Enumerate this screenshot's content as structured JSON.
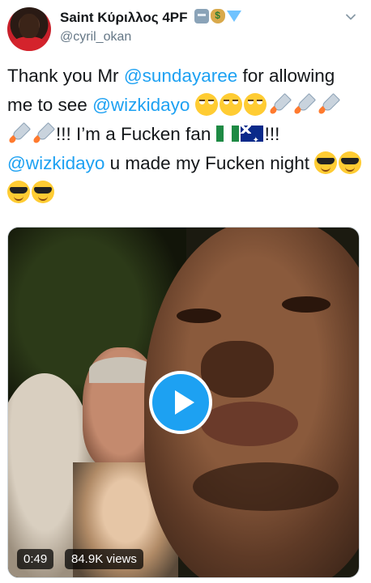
{
  "user": {
    "display_name": "Saint Κύριλλος 4PF",
    "handle": "@cyril_okan",
    "name_emojis": [
      "robot-emoji",
      "money-bag-emoji",
      "gem-emoji"
    ]
  },
  "tweet": {
    "segments": [
      {
        "text": "Thank you Mr ",
        "type": "text"
      },
      {
        "text": "@sundayaree",
        "type": "mention"
      },
      {
        "text": " for allowing me to see ",
        "type": "text"
      },
      {
        "text": "@wizkidayo",
        "type": "mention"
      },
      {
        "text": " ",
        "type": "text"
      }
    ],
    "part2": "!!! I’m a Fucken fan ",
    "part3": "!!! ",
    "mention3": "@wizkidayo",
    "part4": " u made my Fucken night ",
    "emoji_sequence_1": [
      "face-with-rolling-eyes",
      "face-with-rolling-eyes",
      "face-with-rolling-eyes"
    ],
    "emoji_sequence_rockets": [
      "rocket",
      "rocket",
      "rocket",
      "rocket",
      "rocket"
    ],
    "flags": [
      "nigeria-flag",
      "australia-flag"
    ],
    "emoji_sequence_end": [
      "smiling-face-with-sunglasses",
      "smiling-face-with-sunglasses",
      "smiling-face-with-sunglasses",
      "smiling-face-with-sunglasses"
    ]
  },
  "media": {
    "duration": "0:49",
    "views": "84.9K views",
    "play_icon": "play-icon"
  },
  "colors": {
    "link": "#1da1f2",
    "text": "#14171a",
    "secondary": "#657786"
  }
}
